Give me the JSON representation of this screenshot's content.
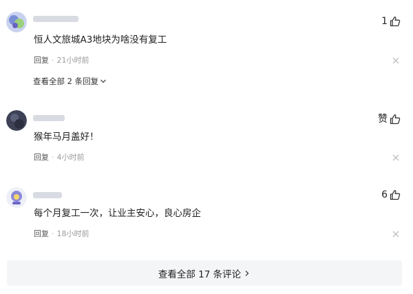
{
  "comments": [
    {
      "likes": "1",
      "text": "恒人文旅城A3地块为啥没有复工",
      "reply_label": "回复",
      "time": "21小时前",
      "view_replies": "查看全部 2 条回复"
    },
    {
      "likes": "赞",
      "text": "猴年马月盖好！",
      "reply_label": "回复",
      "time": "4小时前"
    },
    {
      "likes": "6",
      "text": "每个月复工一次，让业主安心，良心房企",
      "reply_label": "回复",
      "time": "18小时前"
    }
  ],
  "footer": {
    "label": "查看全部 17 条评论"
  },
  "icons": {
    "like": "thumbs-up-icon",
    "close": "close-icon",
    "expand": "chevron-down-icon",
    "more": "chevron-right-icon"
  }
}
